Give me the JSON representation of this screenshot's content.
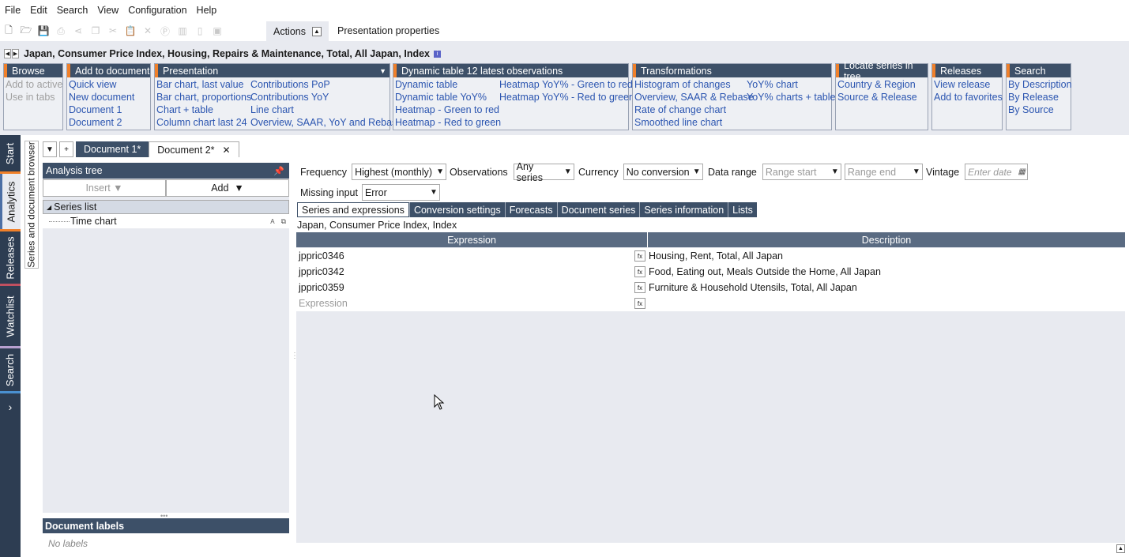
{
  "menu": [
    "File",
    "Edit",
    "Search",
    "View",
    "Configuration",
    "Help"
  ],
  "toolbar": {
    "actions_label": "Actions",
    "presentation_properties": "Presentation properties"
  },
  "series_title": "Japan, Consumer Price Index, Housing, Repairs & Maintenance, Total, All Japan, Index",
  "ribbon": {
    "browse": {
      "title": "Browse",
      "items": [
        "Add to active",
        "Use in tabs"
      ]
    },
    "add_to_document": {
      "title": "Add to document",
      "items": [
        "Quick view",
        "New document",
        "Document 1",
        "Document 2"
      ]
    },
    "presentation": {
      "title": "Presentation",
      "col1": [
        "Bar chart, last value",
        "Bar chart, proportions",
        "Chart + table",
        "Column chart last 24"
      ],
      "col2": [
        "Contributions PoP",
        "Contributions YoY",
        "Line chart",
        "Overview, SAAR, YoY and Rebase"
      ]
    },
    "dynamic_table": {
      "title": "Dynamic table 12 latest observations",
      "col1": [
        "Dynamic table",
        "Dynamic table YoY%",
        "Heatmap - Green to red",
        "Heatmap - Red to green"
      ],
      "col2": [
        "Heatmap YoY% - Green to red",
        "Heatmap YoY% - Red to green"
      ]
    },
    "transformations": {
      "title": "Transformations",
      "col1": [
        "Histogram of changes",
        "Overview, SAAR & Rebase",
        "Rate of change chart",
        "Smoothed line chart"
      ],
      "col2": [
        "YoY% chart",
        "YoY% charts + table"
      ]
    },
    "locate": {
      "title": "Locate series in tree",
      "items": [
        "Country & Region",
        "Source & Release"
      ]
    },
    "releases": {
      "title": "Releases",
      "items": [
        "View release",
        "Add to favorites"
      ]
    },
    "search": {
      "title": "Search",
      "items": [
        "By Description",
        "By Release",
        "By Source"
      ]
    }
  },
  "sidebar_tabs": [
    "Start",
    "Analytics",
    "Releases",
    "Watchlist",
    "Search"
  ],
  "series_doc_browser": "Series and document browser",
  "doc_tabs": [
    {
      "label": "Document 1*"
    },
    {
      "label": "Document 2*"
    }
  ],
  "analysis_tree": {
    "title": "Analysis tree",
    "insert": "Insert",
    "add": "Add",
    "items": [
      "Series list",
      "Time chart"
    ]
  },
  "document_labels": {
    "title": "Document labels",
    "empty": "No labels"
  },
  "filters": {
    "frequency_label": "Frequency",
    "frequency": "Highest (monthly)",
    "observations_label": "Observations",
    "observations": "Any series",
    "currency_label": "Currency",
    "currency": "No conversion",
    "data_range_label": "Data range",
    "range_start": "Range start",
    "range_end": "Range end",
    "vintage_label": "Vintage",
    "vintage_placeholder": "Enter date",
    "missing_input_label": "Missing input",
    "missing_input": "Error"
  },
  "sub_tabs": [
    "Series and expressions",
    "Conversion settings",
    "Forecasts",
    "Document series",
    "Series information",
    "Lists"
  ],
  "grid": {
    "title": "Japan, Consumer Price Index, Index",
    "columns": [
      "Expression",
      "Description"
    ],
    "rows": [
      {
        "expr": "jppric0346",
        "desc": "Housing, Rent, Total, All Japan"
      },
      {
        "expr": "jppric0342",
        "desc": "Food, Eating out, Meals Outside the Home, All Japan"
      },
      {
        "expr": "jppric0359",
        "desc": "Furniture & Household Utensils, Total, All Japan"
      }
    ],
    "placeholder": "Expression"
  }
}
